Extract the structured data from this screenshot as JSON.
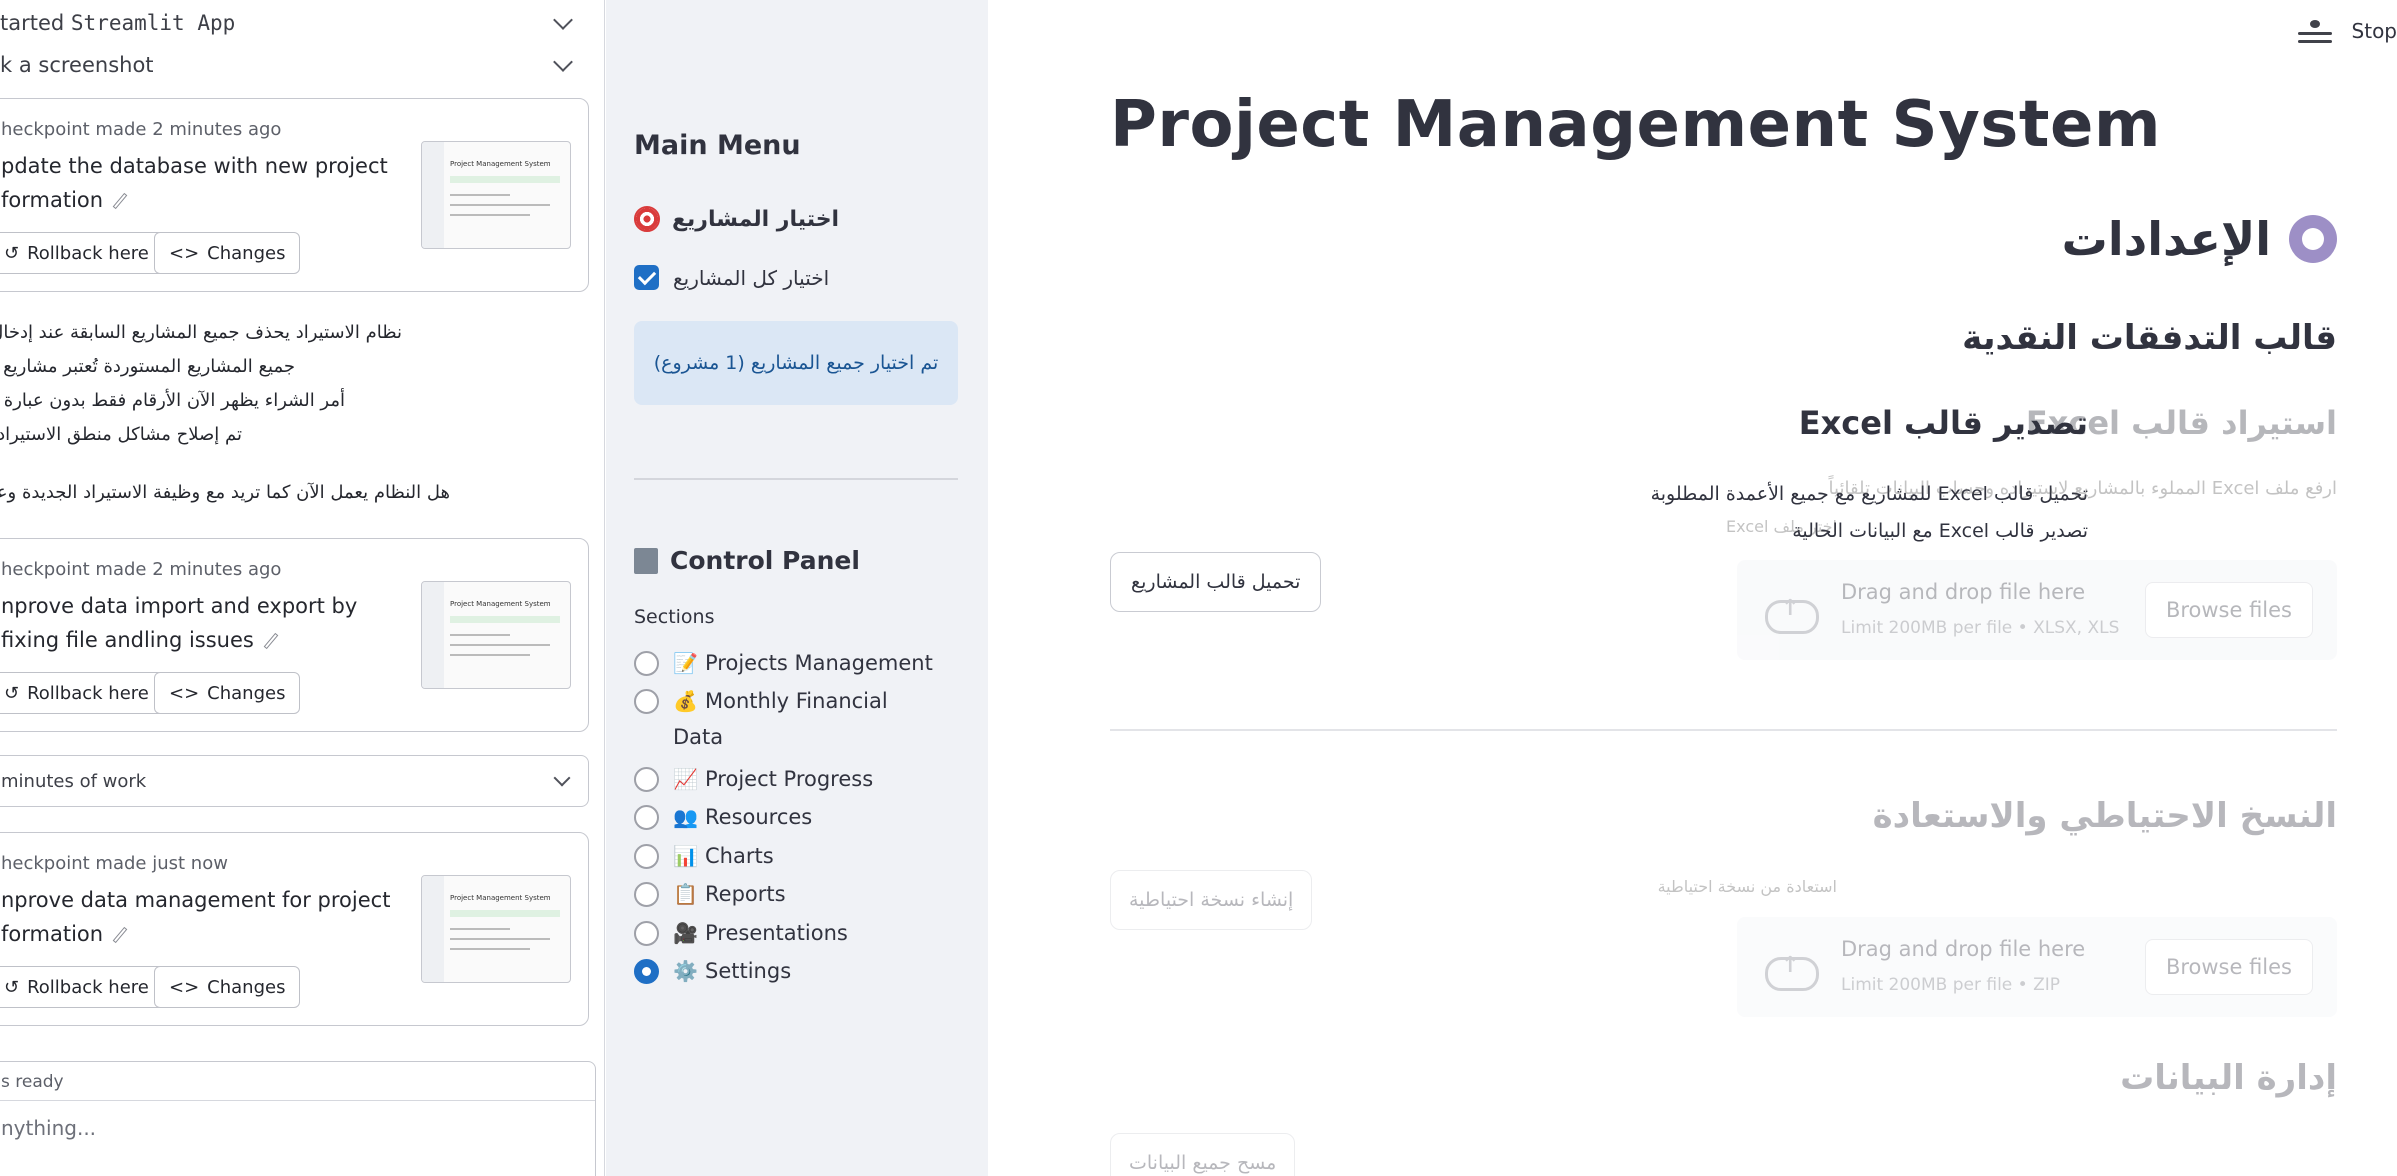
{
  "agent": {
    "top_rows": [
      {
        "prefix": "tarted ",
        "code": "Streamlit App"
      },
      {
        "prefix": "k a screenshot",
        "code": ""
      }
    ],
    "checkpoints": [
      {
        "meta": "heckpoint made 2 minutes ago",
        "title": "pdate the database with new project formation",
        "rollback": "Rollback here",
        "changes": "Changes",
        "thumb_title": "Project Management System"
      },
      {
        "meta": "heckpoint made 2 minutes ago",
        "title": "nprove data import and export by fixing file andling issues",
        "rollback": "Rollback here",
        "changes": "Changes",
        "thumb_title": "Project Management System"
      },
      {
        "meta": "heckpoint made just now",
        "title": "nprove data management for project formation",
        "rollback": "Rollback here",
        "changes": "Changes",
        "thumb_title": "Project Management System"
      }
    ],
    "message_lines": [
      "نظام الاستيراد يحذف جميع المشاريع السابقة عند إدخال بيانات",
      "جميع المشاريع المستوردة تُعتبر مشاريع جديد",
      "أمر الشراء يظهر الآن الأرقام فقط بدون عبارة \"غير\"",
      "تم إصلاح مشاكل منطق الاستيراد في",
      "هل النظام يعمل الآن كما تريد مع وظيفة الاستيراد الجديدة وعرض أم"
    ],
    "work_row": "minutes of work",
    "chat_status": "s ready",
    "chat_placeholder": "nything..."
  },
  "sidebar": {
    "main_menu": "Main Menu",
    "project_select_header": "اختيار المشاريع",
    "select_all_label": "اختيار كل المشاريع",
    "select_all_checked": true,
    "info_text": "تم اختيار جميع المشاريع (1 مشروع)",
    "control_panel": "Control Panel",
    "sections_label": "Sections",
    "sections": [
      {
        "emoji": "📝",
        "label": "Projects Management",
        "selected": false
      },
      {
        "emoji": "💰",
        "label": "Monthly Financial Data",
        "selected": false
      },
      {
        "emoji": "📈",
        "label": "Project Progress",
        "selected": false
      },
      {
        "emoji": "👥",
        "label": "Resources",
        "selected": false
      },
      {
        "emoji": "📊",
        "label": "Charts",
        "selected": false
      },
      {
        "emoji": "📋",
        "label": "Reports",
        "selected": false
      },
      {
        "emoji": "🎥",
        "label": "Presentations",
        "selected": false
      },
      {
        "emoji": "⚙️",
        "label": "Settings",
        "selected": true
      }
    ]
  },
  "main": {
    "stop_label": "Stop",
    "page_title": "Project Management System",
    "settings_header": "الإعدادات",
    "cashflow_header": "قالب التدفقات النقدية",
    "export": {
      "header": "تصدير قالب Excel",
      "desc_1": "تحميل قالب Excel للمشاريع مع جميع الأعمدة المطلوبة",
      "desc_2": "تصدير قالب Excel مع البيانات الحالية",
      "button": "تحميل قالب المشاريع"
    },
    "import": {
      "header": "استيراد قالب Excel",
      "desc": "ارفع ملف Excel المملوء بالمشاريع لاستيراده وحساب البيانات تلقائياً",
      "label": "اختر ملف Excel",
      "drop_title": "Drag and drop file here",
      "drop_limit": "Limit 200MB per file • XLSX, XLS",
      "browse": "Browse files"
    },
    "backup": {
      "header": "النسخ الاحتياطي والاستعادة",
      "create_button": "إنشاء نسخة احتياطية",
      "restore_label": "استعادة من نسخة احتياطية",
      "drop_title": "Drag and drop file here",
      "drop_limit": "Limit 200MB per file • ZIP",
      "browse": "Browse files"
    },
    "data_mgmt": {
      "header": "إدارة البيانات",
      "clear_button": "مسح جميع البيانات"
    }
  }
}
